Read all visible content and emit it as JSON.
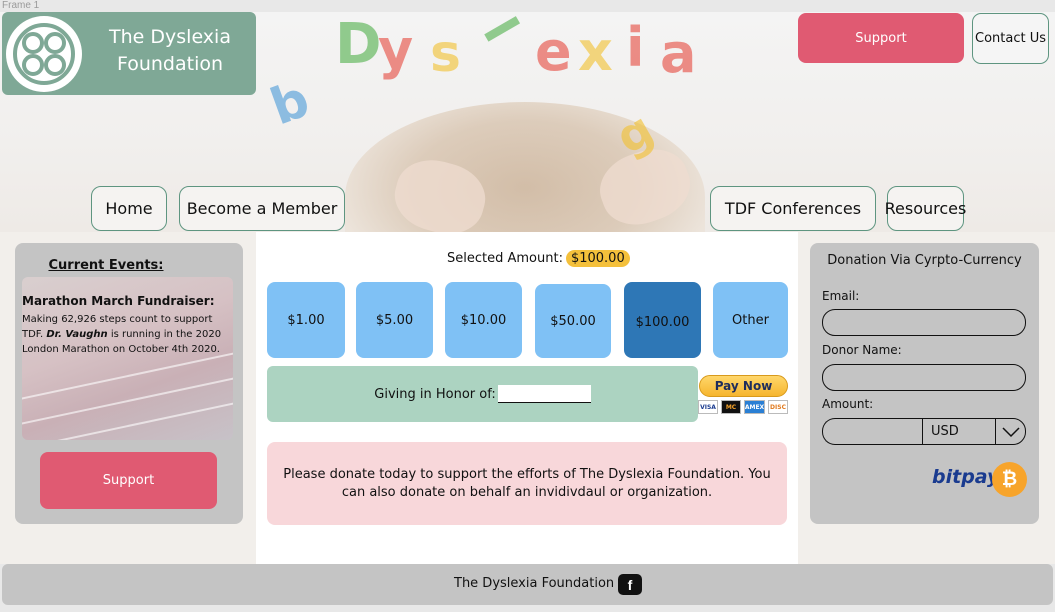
{
  "frame": {
    "label": "Frame 1"
  },
  "hero": {
    "letters": [
      "D",
      "y",
      "s",
      "l",
      "e",
      "x",
      "i",
      "a",
      "b",
      "g"
    ]
  },
  "header": {
    "logo_title": "The Dyslexia Foundation",
    "support_label": "Support",
    "contact_label": "Contact Us"
  },
  "nav": {
    "items": [
      {
        "label": "Home"
      },
      {
        "label": "Become a Member"
      },
      {
        "label": "TDF Conferences"
      },
      {
        "label": "Resources"
      }
    ]
  },
  "events": {
    "title": "Current Events:",
    "name": "Marathon March Fundraiser:",
    "desc_a": "Making 62,926 steps count to support TDF. ",
    "desc_name": "Dr. Vaughn",
    "desc_b": " is running in the 2020 London Marathon on October 4th 2020.",
    "support_label": "Support"
  },
  "donation": {
    "selected_label": "Selected Amount:",
    "selected_value": "$100.00",
    "amounts": [
      "$1.00",
      "$5.00",
      "$10.00",
      "$50.00",
      "$100.00",
      "Other"
    ],
    "selected_index": 4,
    "honor_label": "Giving in Honor of:",
    "paynow_label": "Pay Now",
    "cards": [
      "VISA",
      "MC",
      "AMEX",
      "DISC"
    ],
    "message": "Please donate today to support the efforts of The Dyslexia Foundation. You can also donate on behalf an invidivdaul or organization."
  },
  "crypto": {
    "title": "Donation Via Cyrpto-Currency",
    "email_label": "Email:",
    "name_label": "Donor Name:",
    "amount_label": "Amount:",
    "currency": "USD",
    "bitpay_label": "bitpay",
    "btc_symbol": "₿"
  },
  "footer": {
    "text": "The Dyslexia Foundation",
    "fb_label": "f"
  },
  "colors": {
    "accent_green": "#7fa896",
    "support_pink": "#e05a72",
    "amount_blue": "#7fc1f5",
    "amount_selected": "#2e77b6",
    "badge_yellow": "#f4c03b"
  }
}
